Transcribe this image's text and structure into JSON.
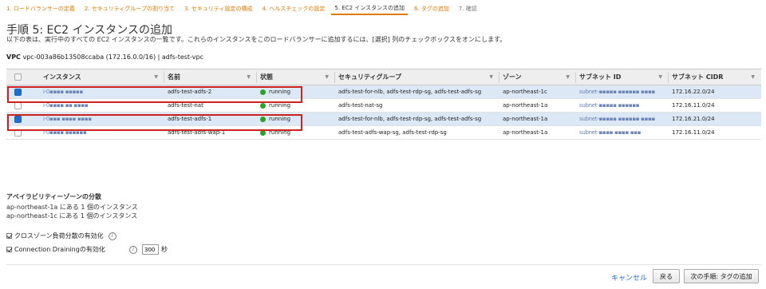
{
  "steps": [
    {
      "label": "1. ロードバランサーの定義"
    },
    {
      "label": "2. セキュリティグループの割り当て"
    },
    {
      "label": "3. セキュリティ設定の構成"
    },
    {
      "label": "4. ヘルスチェックの設定"
    },
    {
      "label": "5. EC2 インスタンスの追加"
    },
    {
      "label": "6. タグの追加"
    },
    {
      "label": "7. 確認"
    }
  ],
  "page": {
    "title": "手順 5: EC2 インスタンスの追加",
    "description": "以下の表は、実行中のすべての EC2 インスタンスの一覧です。これらのインスタンスをこのロードバランサーに追加するには、[選択] 列のチェックボックスをオンにします。",
    "vpc_label": "VPC",
    "vpc_value": "vpc-003a86b13508ccaba (172.16.0.0/16) | adfs-test-vpc"
  },
  "table": {
    "columns": [
      "インスタンス",
      "名前",
      "状態",
      "セキュリティグループ",
      "ゾーン",
      "サブネット ID",
      "サブネット CIDR"
    ],
    "rows": [
      {
        "selected": true,
        "instance": "i-0▪▪▪▪ ▪▪▪▪▪",
        "name": "adfs-test-adfs-2",
        "state": "running",
        "sg": "adfs-test-for-nlb, adfs-test-rdp-sg, adfs-test-adfs-sg",
        "zone": "ap-northeast-1c",
        "subnet": "subnet-▪▪▪▪▪ ▪▪▪▪▪▪ ▪▪▪▪",
        "cidr": "172.16.22.0/24"
      },
      {
        "selected": false,
        "instance": "i-0▪▪▪▪ ▪▪ ▪▪▪▪",
        "name": "adfs-test-nat",
        "state": "running",
        "sg": "adfs-test-nat-sg",
        "zone": "ap-northeast-1a",
        "subnet": "subnet-▪▪▪▪▪ ▪▪▪▪▪▪",
        "cidr": "172.16.11.0/24"
      },
      {
        "selected": true,
        "instance": "i-0▪▪▪ ▪▪▪▪ ▪▪▪▪",
        "name": "adfs-test-adfs-1",
        "state": "running",
        "sg": "adfs-test-for-nlb, adfs-test-rdp-sg, adfs-test-adfs-sg",
        "zone": "ap-northeast-1a",
        "subnet": "subnet-▪▪▪▪▪ ▪▪▪▪▪▪ ▪▪▪▪",
        "cidr": "172.16.21.0/24"
      },
      {
        "selected": false,
        "instance": "i-0▪▪▪▪ ▪▪▪▪▪▪",
        "name": "adfs-test-adfs-wap-1",
        "state": "running",
        "sg": "adfs-test-adfs-wap-sg, adfs-test-rdp-sg",
        "zone": "ap-northeast-1a",
        "subnet": "subnet-▪▪▪▪ ▪▪▪▪ ▪▪▪",
        "cidr": "172.16.11.0/24"
      }
    ]
  },
  "az": {
    "title": "アベイラビリティーゾーンの分散",
    "lines": [
      "ap-northeast-1a にある 1 個のインスタンス",
      "ap-northeast-1c にある 1 個のインスタンス"
    ]
  },
  "options": {
    "cross_zone_label": "クロスゾーン負荷分散の有効化",
    "draining_label": "Connection Drainingの有効化",
    "draining_value": "300",
    "draining_unit": "秒",
    "info_glyph": "i"
  },
  "footer": {
    "cancel_label": "キャンセル",
    "back_label": "戻る",
    "next_label": "次の手順: タグの追加"
  },
  "colors": {
    "accent": "#e07b00",
    "link": "#1f6fd1",
    "selected_row": "#dde8f6",
    "highlight_box": "#d0211c",
    "running": "#2aa22a"
  }
}
